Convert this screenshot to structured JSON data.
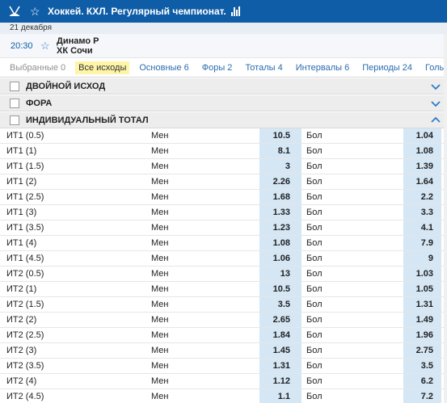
{
  "header": {
    "sport_icon": "hockey-sticks-icon",
    "star_icon": "star-outline-icon",
    "title": "Хоккей. КХЛ. Регулярный чемпионат.",
    "stats_icon": "bar-chart-icon"
  },
  "date": "21 декабря",
  "match": {
    "time": "20:30",
    "team1": "Динамо Р",
    "team2": "ХК Сочи"
  },
  "filters": [
    {
      "label": "Выбранные 0",
      "state": "disabled"
    },
    {
      "label": "Все исходы",
      "state": "active"
    },
    {
      "label": "Основные 6",
      "state": "normal"
    },
    {
      "label": "Форы 2",
      "state": "normal"
    },
    {
      "label": "Тоталы 4",
      "state": "normal"
    },
    {
      "label": "Интервалы 6",
      "state": "normal"
    },
    {
      "label": "Периоды 24",
      "state": "normal"
    },
    {
      "label": "Голы",
      "state": "normal"
    }
  ],
  "groups": [
    {
      "name": "ДВОЙНОЙ ИСХОД",
      "chevron": "chevron-down-icon"
    },
    {
      "name": "ФОРА",
      "chevron": "chevron-down-icon"
    },
    {
      "name": "ИНДИВИДУАЛЬНЫЙ ТОТАЛ",
      "chevron": "chevron-up-icon"
    }
  ],
  "odds": {
    "under_label": "Мен",
    "over_label": "Бол",
    "rows": [
      {
        "label": "ИТ1 (0.5)",
        "under": "10.5",
        "over": "1.04"
      },
      {
        "label": "ИТ1 (1)",
        "under": "8.1",
        "over": "1.08"
      },
      {
        "label": "ИТ1 (1.5)",
        "under": "3",
        "over": "1.39"
      },
      {
        "label": "ИТ1 (2)",
        "under": "2.26",
        "over": "1.64"
      },
      {
        "label": "ИТ1 (2.5)",
        "under": "1.68",
        "over": "2.2"
      },
      {
        "label": "ИТ1 (3)",
        "under": "1.33",
        "over": "3.3"
      },
      {
        "label": "ИТ1 (3.5)",
        "under": "1.23",
        "over": "4.1"
      },
      {
        "label": "ИТ1 (4)",
        "under": "1.08",
        "over": "7.9"
      },
      {
        "label": "ИТ1 (4.5)",
        "under": "1.06",
        "over": "9"
      },
      {
        "label": "ИТ2 (0.5)",
        "under": "13",
        "over": "1.03"
      },
      {
        "label": "ИТ2 (1)",
        "under": "10.5",
        "over": "1.05"
      },
      {
        "label": "ИТ2 (1.5)",
        "under": "3.5",
        "over": "1.31"
      },
      {
        "label": "ИТ2 (2)",
        "under": "2.65",
        "over": "1.49"
      },
      {
        "label": "ИТ2 (2.5)",
        "under": "1.84",
        "over": "1.96"
      },
      {
        "label": "ИТ2 (3)",
        "under": "1.45",
        "over": "2.75"
      },
      {
        "label": "ИТ2 (3.5)",
        "under": "1.31",
        "over": "3.5"
      },
      {
        "label": "ИТ2 (4)",
        "under": "1.12",
        "over": "6.2"
      },
      {
        "label": "ИТ2 (4.5)",
        "under": "1.1",
        "over": "7.2"
      }
    ]
  },
  "colors": {
    "header_bg": "#0f5da6",
    "odds_cell_bg": "#d5e6f5",
    "active_filter_bg": "#fff5a8",
    "link": "#2a6bb0"
  }
}
